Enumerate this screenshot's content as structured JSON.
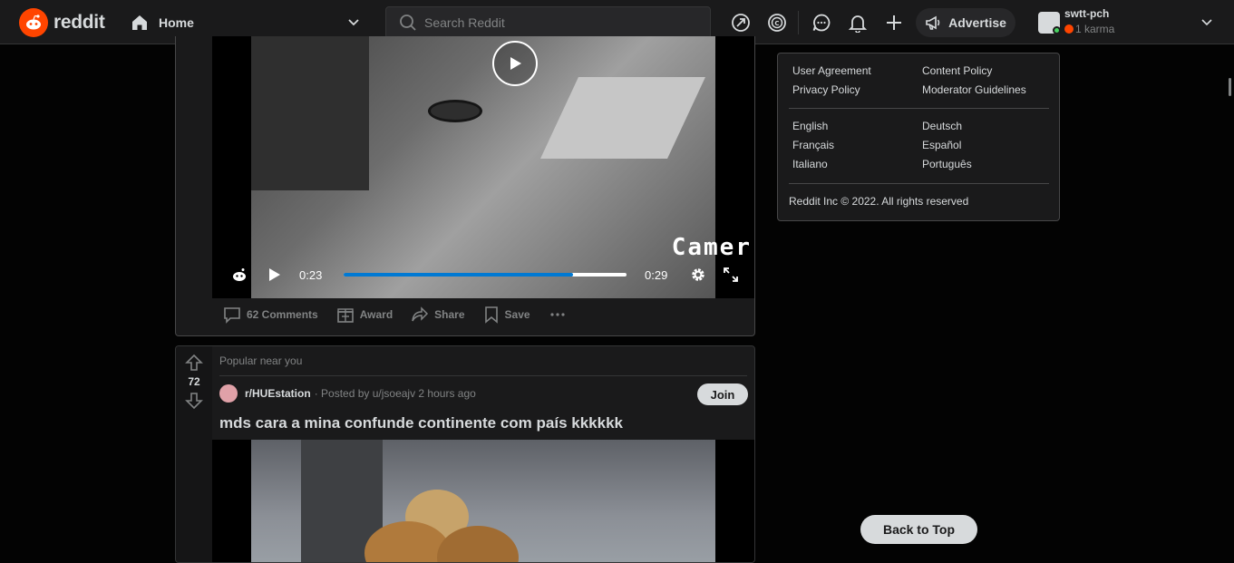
{
  "header": {
    "logo_text": "reddit",
    "home_label": "Home",
    "search_placeholder": "Search Reddit",
    "advertise_label": "Advertise",
    "username": "swtt-pch",
    "karma": "1 karma",
    "icons": [
      "popular-icon",
      "coin-icon",
      "chat-icon",
      "notification-icon",
      "create-post-icon"
    ]
  },
  "post1": {
    "overlay_text": "Camer",
    "current_time": "0:23",
    "duration": "0:29",
    "progress": 0.81,
    "actions": {
      "comments": "62 Comments",
      "award": "Award",
      "share": "Share",
      "save": "Save"
    }
  },
  "post2": {
    "section_label": "Popular near you",
    "votes": "72",
    "subreddit": "r/HUEstation",
    "posted_by": "· Posted by u/jsoeajv 2 hours ago",
    "join_label": "Join",
    "title": "mds cara a mina confunde continente com país kkkkkk"
  },
  "sidebar": {
    "links": [
      "User Agreement",
      "Content Policy",
      "Privacy Policy",
      "Moderator Guidelines"
    ],
    "languages": [
      "English",
      "Deutsch",
      "Français",
      "Español",
      "Italiano",
      "Português"
    ],
    "copyright": "Reddit Inc © 2022. All rights reserved"
  },
  "back_to_top": "Back to Top",
  "colors": {
    "accent": "#ff4500",
    "progress": "#0079d3",
    "background": "#030303",
    "card": "#1a1a1b"
  }
}
